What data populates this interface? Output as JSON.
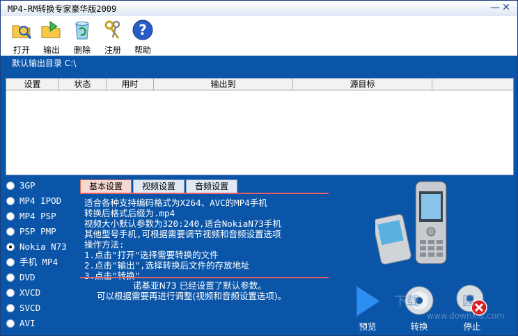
{
  "window": {
    "title": "MP4-RM转换专家豪华版2009",
    "minimize": "—",
    "close": "✕"
  },
  "toolbar": [
    {
      "label": "打开",
      "icon": "open-folder-icon"
    },
    {
      "label": "输出",
      "icon": "output-folder-icon"
    },
    {
      "label": "删除",
      "icon": "recycle-bin-icon"
    },
    {
      "label": "注册",
      "icon": "keys-icon"
    },
    {
      "label": "帮助",
      "icon": "help-icon"
    }
  ],
  "output_dir": "默认输出目录 C:\\",
  "table": {
    "columns": [
      "设置",
      "状态",
      "用时",
      "输出到",
      "源目标"
    ]
  },
  "devices": [
    {
      "label": "3GP",
      "selected": false
    },
    {
      "label": "MP4 IPOD",
      "selected": false
    },
    {
      "label": "MP4 PSP",
      "selected": false
    },
    {
      "label": "PSP PMP",
      "selected": false
    },
    {
      "label": "Nokia N73",
      "selected": true
    },
    {
      "label": "手机 MP4",
      "selected": false
    },
    {
      "label": "DVD",
      "selected": false
    },
    {
      "label": "XVCD",
      "selected": false
    },
    {
      "label": "SVCD",
      "selected": false
    },
    {
      "label": "AVI",
      "selected": false
    }
  ],
  "tabs": {
    "basic": "基本设置",
    "video": "视频设置",
    "audio": "音频设置"
  },
  "info_lines": [
    "适合各种支持编码格式为X264、AVC的MP4手机",
    "转换后格式后缀为.mp4",
    "视频大小默认参数为320:240,适合NokiaN73手机",
    "其他型号手机,可根据需要调节视频和音频设置选项",
    "操作方法:",
    "1.点击\"打开\"选择需要转换的文件",
    "2.点击\"输出\",选择转换后文件的存放地址",
    "3.点击\"转换\""
  ],
  "note": {
    "line1": "诺基亚N73 已经设置了默认参数。",
    "line2": "可以根据需要再进行调整(视频和音频设置选项)。"
  },
  "actions": {
    "preview": "预览",
    "convert": "转换",
    "stop": "停止"
  },
  "watermark": {
    "text": "下载",
    "text2": "园",
    "url": "www.downxia.com"
  },
  "colors": {
    "background": "#0a55a8",
    "accent_red": "#e8606a"
  }
}
